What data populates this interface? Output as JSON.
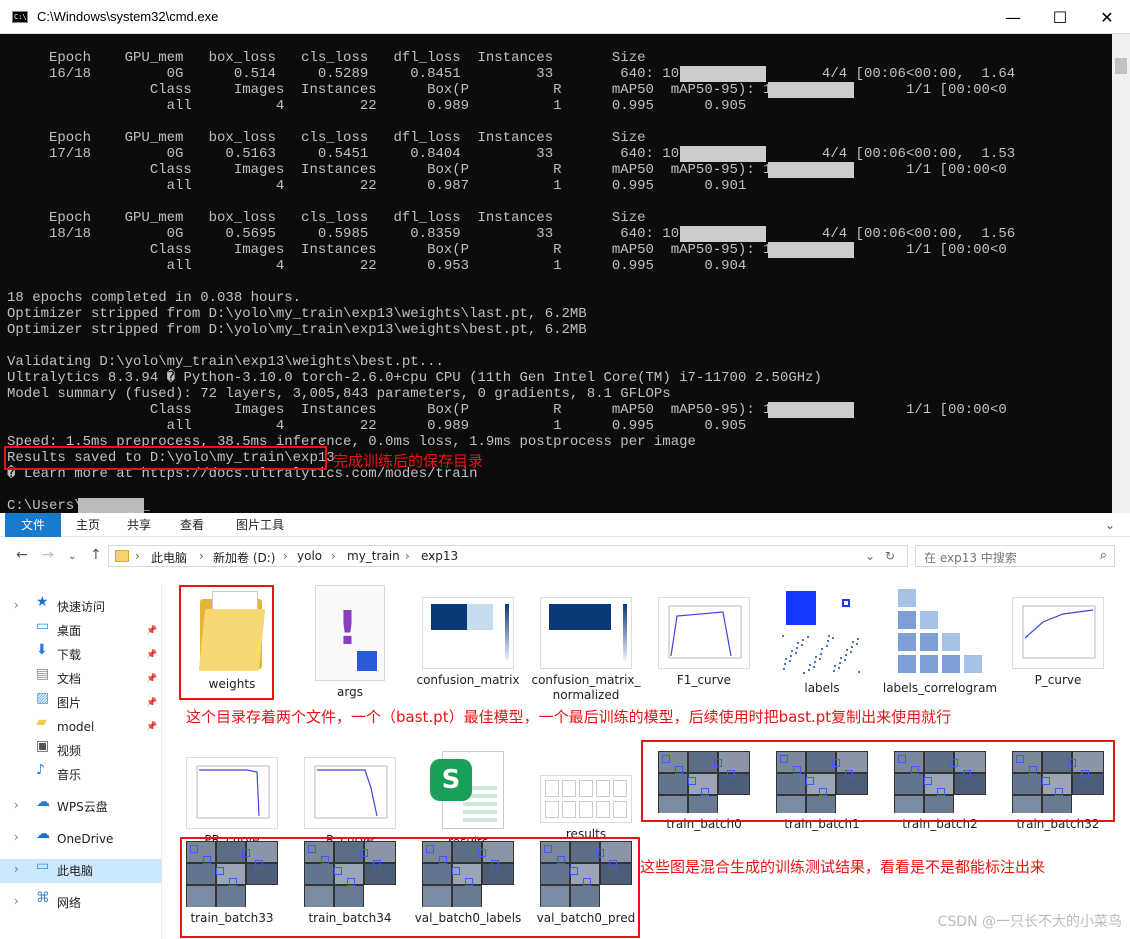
{
  "cmd": {
    "title": "C:\\Windows\\system32\\cmd.exe",
    "icon_text": "C:\\",
    "lines": [
      "     Epoch    GPU_mem   box_loss   cls_loss   dfl_loss  Instances       Size",
      "     16/18         0G      0.514     0.5289     0.8451         33        640: 100%|              4/4 [00:06<00:00,  1.64",
      "                 Class     Images  Instances      Box(P          R      mAP50  mAP50-95): 100%|            1/1 [00:00<0",
      "                   all          4         22      0.989          1      0.995      0.905",
      "",
      "     Epoch    GPU_mem   box_loss   cls_loss   dfl_loss  Instances       Size",
      "     17/18         0G     0.5163     0.5451     0.8404         33        640: 100%|              4/4 [00:06<00:00,  1.53",
      "                 Class     Images  Instances      Box(P          R      mAP50  mAP50-95): 100%|            1/1 [00:00<0",
      "                   all          4         22      0.987          1      0.995      0.901",
      "",
      "     Epoch    GPU_mem   box_loss   cls_loss   dfl_loss  Instances       Size",
      "     18/18         0G     0.5695     0.5985     0.8359         33        640: 100%|              4/4 [00:06<00:00,  1.56",
      "                 Class     Images  Instances      Box(P          R      mAP50  mAP50-95): 100%|            1/1 [00:00<0",
      "                   all          4         22      0.953          1      0.995      0.904",
      "",
      "18 epochs completed in 0.038 hours.",
      "Optimizer stripped from D:\\yolo\\my_train\\exp13\\weights\\last.pt, 6.2MB",
      "Optimizer stripped from D:\\yolo\\my_train\\exp13\\weights\\best.pt, 6.2MB",
      "",
      "Validating D:\\yolo\\my_train\\exp13\\weights\\best.pt...",
      "Ultralytics 8.3.94 � Python-3.10.0 torch-2.6.0+cpu CPU (11th Gen Intel Core(TM) i7-11700 2.50GHz)",
      "Model summary (fused): 72 layers, 3,005,843 parameters, 0 gradients, 8.1 GFLOPs",
      "                 Class     Images  Instances      Box(P          R      mAP50  mAP50-95): 100%|            1/1 [00:00<0",
      "                   all          4         22      0.989          1      0.995      0.905",
      "Speed: 1.5ms preprocess, 38.5ms inference, 0.0ms loss, 1.9ms postprocess per image",
      "Results saved to D:\\yolo\\my_train\\exp13",
      "� Learn more at https://docs.ultralytics.com/modes/train",
      "",
      "C:\\Users\\      >_"
    ],
    "note_saved": "完成训练后的保存目录"
  },
  "explorer": {
    "tabs": [
      "文件",
      "主页",
      "共享",
      "查看",
      "图片工具"
    ],
    "breadcrumb": [
      "此电脑",
      "新加卷 (D:)",
      "yolo",
      "my_train",
      "exp13"
    ],
    "search_placeholder": "在 exp13 中搜索",
    "sidebar": [
      {
        "label": "快速访问",
        "icon": "star-icon",
        "pinned": false
      },
      {
        "label": "桌面",
        "icon": "desktop-icon",
        "pinned": true
      },
      {
        "label": "下载",
        "icon": "download-icon",
        "pinned": true
      },
      {
        "label": "文档",
        "icon": "document-icon",
        "pinned": true
      },
      {
        "label": "图片",
        "icon": "pictures-icon",
        "pinned": true
      },
      {
        "label": "model",
        "icon": "folder-icon",
        "pinned": true
      },
      {
        "label": "视频",
        "icon": "video-icon",
        "pinned": false
      },
      {
        "label": "音乐",
        "icon": "music-icon",
        "pinned": false
      },
      {
        "label": "WPS云盘",
        "icon": "cloud-icon",
        "pinned": false
      },
      {
        "label": "OneDrive",
        "icon": "onedrive-icon",
        "pinned": false
      },
      {
        "label": "此电脑",
        "icon": "computer-icon",
        "pinned": false
      },
      {
        "label": "网络",
        "icon": "network-icon",
        "pinned": false
      }
    ],
    "files": [
      {
        "name": "weights",
        "kind": "folder"
      },
      {
        "name": "args",
        "kind": "yaml"
      },
      {
        "name": "confusion_matrix",
        "kind": "matrix"
      },
      {
        "name": "confusion_matrix_normalized",
        "kind": "matrix"
      },
      {
        "name": "F1_curve",
        "kind": "curve"
      },
      {
        "name": "labels",
        "kind": "labels"
      },
      {
        "name": "labels_correlogram",
        "kind": "correlogram"
      },
      {
        "name": "P_curve",
        "kind": "curve"
      },
      {
        "name": "PR_curve",
        "kind": "curve"
      },
      {
        "name": "R_curve",
        "kind": "curve"
      },
      {
        "name": "results",
        "kind": "csv"
      },
      {
        "name": "results",
        "kind": "grid"
      },
      {
        "name": "train_batch0",
        "kind": "mosaic"
      },
      {
        "name": "train_batch1",
        "kind": "mosaic"
      },
      {
        "name": "train_batch2",
        "kind": "mosaic"
      },
      {
        "name": "train_batch32",
        "kind": "mosaic"
      },
      {
        "name": "train_batch33",
        "kind": "mosaic"
      },
      {
        "name": "train_batch34",
        "kind": "mosaic"
      },
      {
        "name": "val_batch0_labels",
        "kind": "mosaic"
      },
      {
        "name": "val_batch0_pred",
        "kind": "mosaic"
      }
    ],
    "note_weights": "这个目录存着两个文件，一个（bast.pt）最佳模型，一个最后训练的模型，后续使用时把bast.pt复制出来使用就行",
    "note_batches": "这些图是混合生成的训练测试结果，看看是不是都能标注出来"
  },
  "watermark": "CSDN @一只长不大的小菜鸟",
  "colors": {
    "annotation": "#e11",
    "terminal_bg": "#0c0c0c",
    "terminal_fg": "#c0c0c0",
    "ribbon_active": "#1979ca"
  }
}
